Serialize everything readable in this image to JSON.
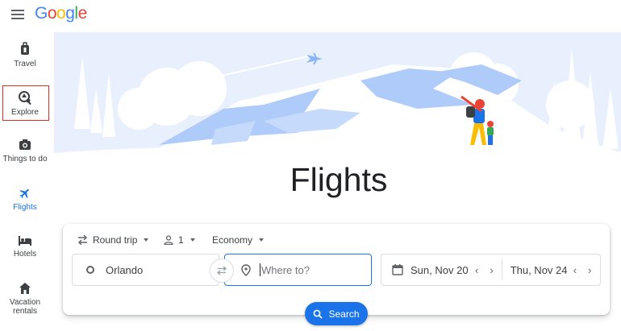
{
  "header": {
    "logo_letters": [
      {
        "char": "G",
        "color": "#4285f4"
      },
      {
        "char": "o",
        "color": "#ea4335"
      },
      {
        "char": "o",
        "color": "#fbbc05"
      },
      {
        "char": "g",
        "color": "#4285f4"
      },
      {
        "char": "l",
        "color": "#34a853"
      },
      {
        "char": "e",
        "color": "#ea4335"
      }
    ]
  },
  "sidebar": {
    "items": [
      {
        "label": "Travel",
        "icon": "luggage-icon"
      },
      {
        "label": "Explore",
        "icon": "explore-icon"
      },
      {
        "label": "Things to do",
        "icon": "camera-icon"
      },
      {
        "label": "Flights",
        "icon": "airplane-icon"
      },
      {
        "label": "Hotels",
        "icon": "bed-icon"
      },
      {
        "label": "Vacation rentals",
        "icon": "house-icon"
      }
    ]
  },
  "main": {
    "title": "Flights",
    "trip_type": "Round trip",
    "passengers": "1",
    "cabin_class": "Economy",
    "origin": "Orlando",
    "destination_placeholder": "Where to?",
    "depart_date": "Sun, Nov 20",
    "return_date": "Thu, Nov 24",
    "search_label": "Search"
  },
  "colors": {
    "accent": "#1a73e8",
    "highlight_box": "#d93025"
  }
}
